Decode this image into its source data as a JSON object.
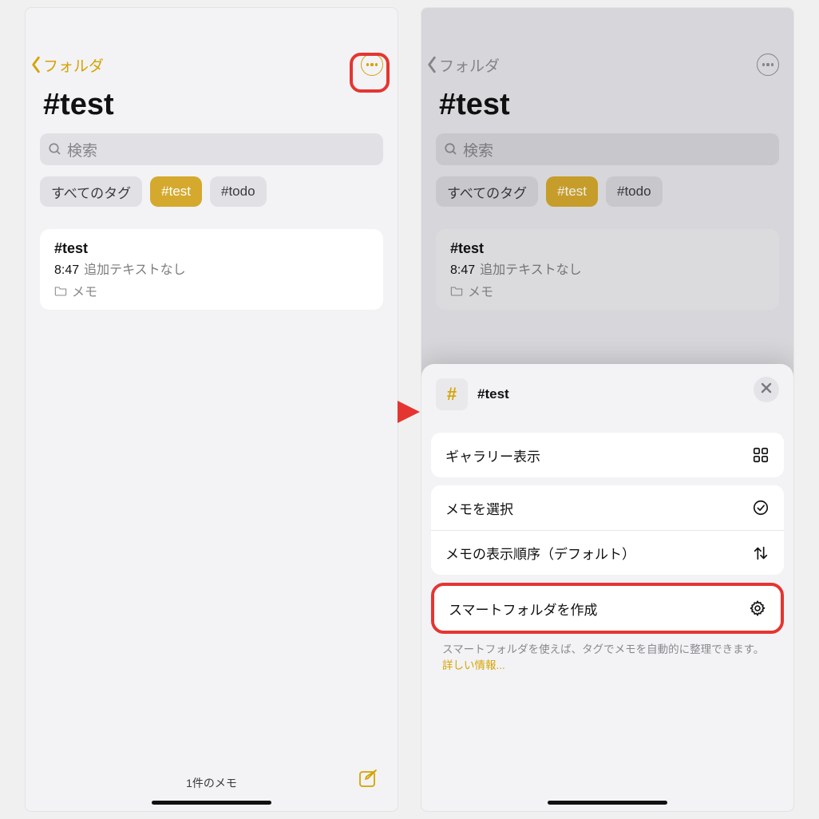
{
  "colors": {
    "accent": "#d6a300",
    "highlight": "#e53531"
  },
  "nav": {
    "back_label": "フォルダ"
  },
  "page_title": "#test",
  "search": {
    "placeholder": "検索"
  },
  "tags": {
    "all_label": "すべてのタグ",
    "items": [
      "#test",
      "#todo"
    ],
    "active_index": 0
  },
  "note": {
    "title": "#test",
    "time": "8:47",
    "subtitle": "追加テキストなし",
    "folder": "メモ"
  },
  "bottom": {
    "count_label": "1件のメモ"
  },
  "sheet": {
    "tag_symbol": "#",
    "title": "#test",
    "rows": {
      "gallery": "ギャラリー表示",
      "select": "メモを選択",
      "sort": "メモの表示順序（デフォルト）",
      "smart_folder": "スマートフォルダを作成"
    },
    "hint_text": "スマートフォルダを使えば、タグでメモを自動的に整理できます。",
    "hint_link": "詳しい情報..."
  }
}
